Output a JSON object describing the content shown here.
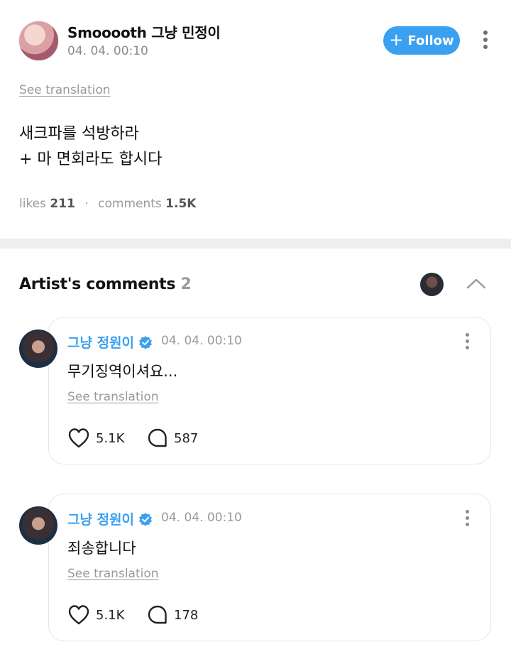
{
  "post": {
    "author": "Smooooth 그냥 민정이",
    "timestamp": "04. 04. 00:10",
    "follow_label": "Follow",
    "translation_label": "See translation",
    "body_line1": "새크파를 석방하라",
    "body_line2": "+ 마 면회라도 합시다",
    "likes_label": "likes",
    "likes_count": "211",
    "comments_label": "comments",
    "comments_count": "1.5K"
  },
  "artist_comments": {
    "title": "Artist's comments",
    "count": "2",
    "items": [
      {
        "author": "그냥 정원이",
        "timestamp": "04. 04. 00:10",
        "text": "무기징역이셔요...",
        "translation_label": "See translation",
        "likes": "5.1K",
        "replies": "587"
      },
      {
        "author": "그냥 정원이",
        "timestamp": "04. 04. 00:10",
        "text": "죄송합니다",
        "translation_label": "See translation",
        "likes": "5.1K",
        "replies": "178"
      }
    ]
  },
  "colors": {
    "accent": "#3aa0f0",
    "muted": "#9a9a9a",
    "divider": "#eeeeee"
  },
  "icons": [
    "plus-icon",
    "more-vertical-icon",
    "chevron-up-icon",
    "verified-badge-icon",
    "heart-icon",
    "comment-bubble-icon"
  ]
}
